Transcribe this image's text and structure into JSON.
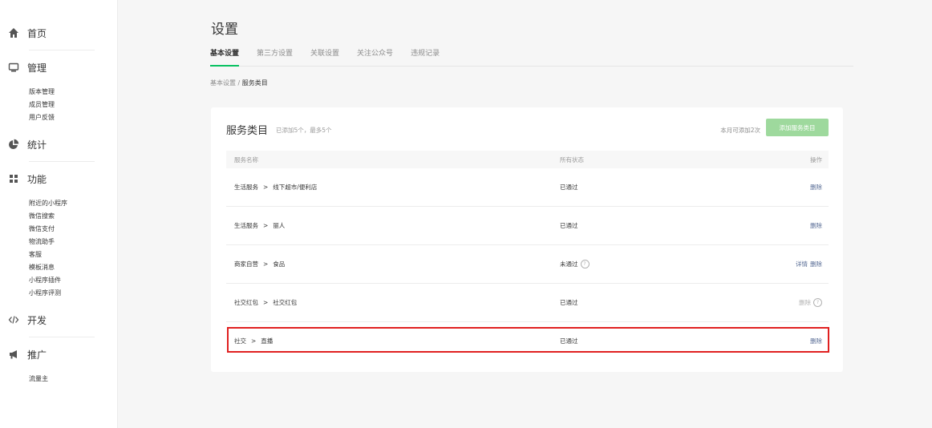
{
  "sidebar": {
    "home": "首页",
    "manage": {
      "label": "管理",
      "items": [
        "版本管理",
        "成员管理",
        "用户反馈"
      ]
    },
    "stats": "统计",
    "features": {
      "label": "功能",
      "items": [
        "附近的小程序",
        "微信搜索",
        "微信支付",
        "物流助手",
        "客服",
        "模板消息",
        "小程序插件",
        "小程序评测"
      ]
    },
    "develop": "开发",
    "promote": {
      "label": "推广",
      "items": [
        "流量主"
      ]
    }
  },
  "page": {
    "title": "设置",
    "tabs": [
      "基本设置",
      "第三方设置",
      "关联设置",
      "关注公众号",
      "违规记录"
    ],
    "breadcrumb": {
      "parent": "基本设置",
      "sep": " / ",
      "current": "服务类目"
    }
  },
  "card": {
    "title": "服务类目",
    "subtitle": "已添加5个，最多5个",
    "quota": "本月可添加2次",
    "add_button": "添加服务类目"
  },
  "table": {
    "headers": {
      "name": "服务名称",
      "status": "所有状态",
      "op": "操作"
    },
    "sep": ">",
    "rows": [
      {
        "cat": "生活服务",
        "sub": "线下超市/便利店",
        "status": "已通过",
        "op1": "删除"
      },
      {
        "cat": "生活服务",
        "sub": "丽人",
        "status": "已通过",
        "op1": "删除"
      },
      {
        "cat": "商家自营",
        "sub": "食品",
        "status": "未通过",
        "op1": "详情",
        "op2": "删除"
      },
      {
        "cat": "社交红包",
        "sub": "社交红包",
        "status": "已通过",
        "op1": "删除"
      },
      {
        "cat": "社交",
        "sub": "直播",
        "status": "已通过",
        "op1": "删除"
      }
    ]
  },
  "icons": {
    "home": "home-icon",
    "manage": "monitor-icon",
    "stats": "pie-chart-icon",
    "features": "grid-icon",
    "develop": "code-icon",
    "promote": "megaphone-icon",
    "help": "question-circle-icon"
  },
  "colors": {
    "accent": "#07c160",
    "link": "#576b95",
    "button": "#9ed99d",
    "highlight": "#e02020"
  }
}
